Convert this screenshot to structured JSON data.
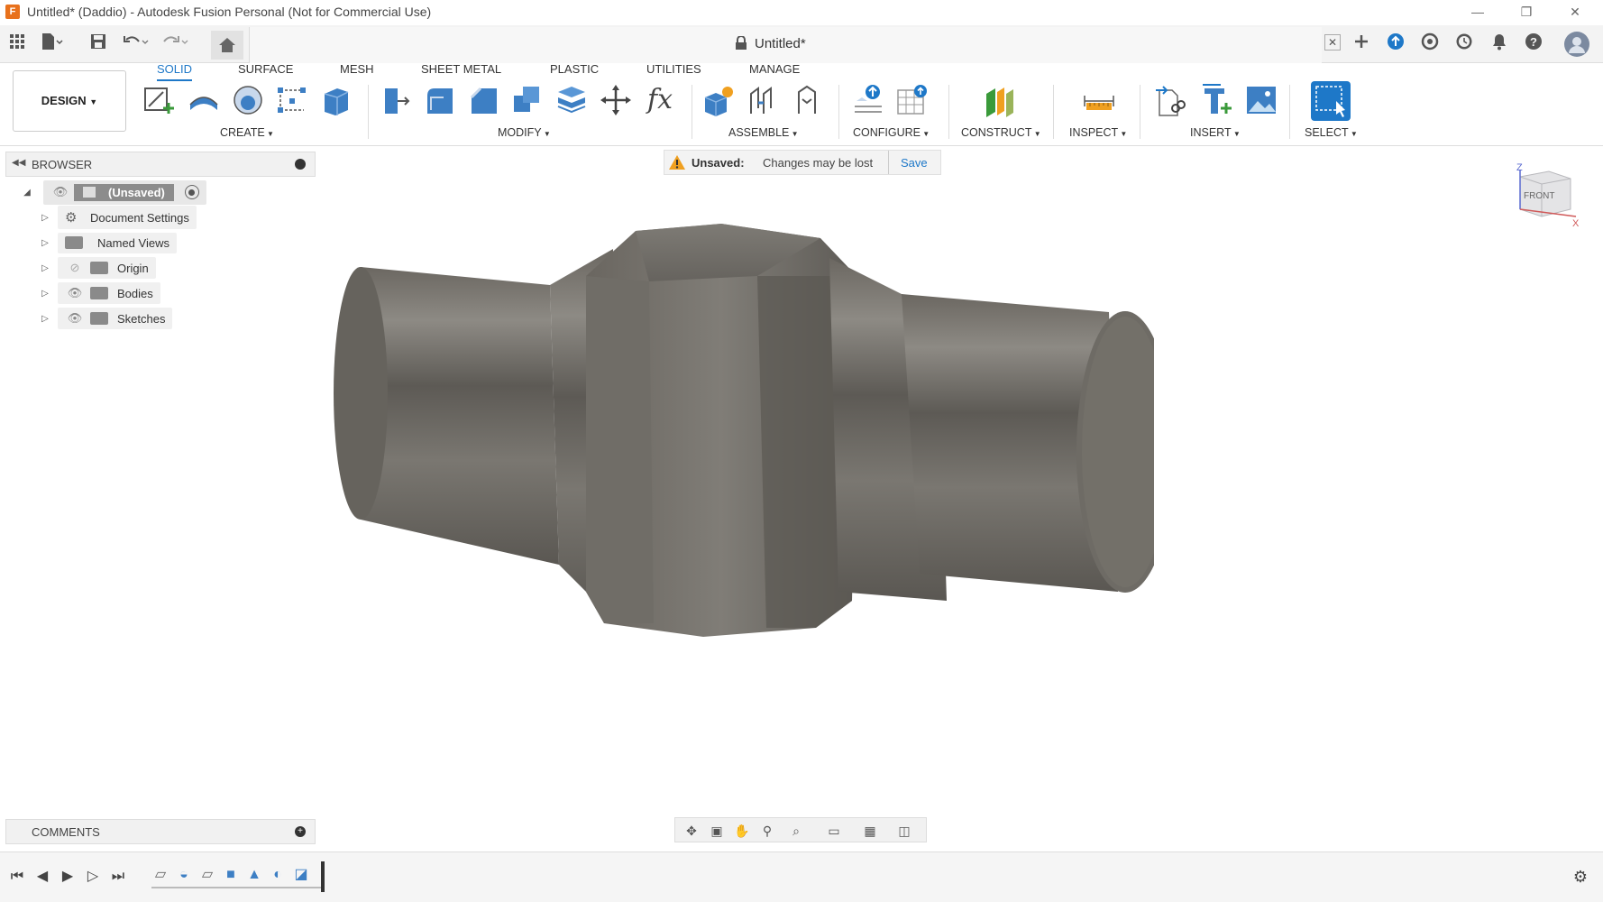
{
  "window": {
    "title": "Untitled* (Daddio) - Autodesk Fusion Personal (Not for Commercial Use)",
    "app_icon_letter": "F",
    "minimize": "—",
    "restore": "❐",
    "close": "✕"
  },
  "document": {
    "tab_title": "Untitled*"
  },
  "ribbon": {
    "workspace": "DESIGN",
    "tabs": [
      "SOLID",
      "SURFACE",
      "MESH",
      "SHEET METAL",
      "PLASTIC",
      "UTILITIES",
      "MANAGE"
    ],
    "active_tab": "SOLID",
    "groups": [
      "CREATE",
      "MODIFY",
      "ASSEMBLE",
      "CONFIGURE",
      "CONSTRUCT",
      "INSPECT",
      "INSERT",
      "SELECT"
    ],
    "fx": "fx"
  },
  "browser": {
    "title": "BROWSER",
    "root": "(Unsaved)",
    "items": [
      "Document Settings",
      "Named Views",
      "Origin",
      "Bodies",
      "Sketches"
    ]
  },
  "banner": {
    "label": "Unsaved:",
    "message": "Changes may be lost",
    "save": "Save"
  },
  "viewcube": {
    "face": "FRONT",
    "z": "Z",
    "x": "X"
  },
  "comments": {
    "title": "COMMENTS"
  },
  "colors": {
    "accent": "#1e78c8",
    "model": "#6f6c66",
    "warning": "#f0a020"
  }
}
